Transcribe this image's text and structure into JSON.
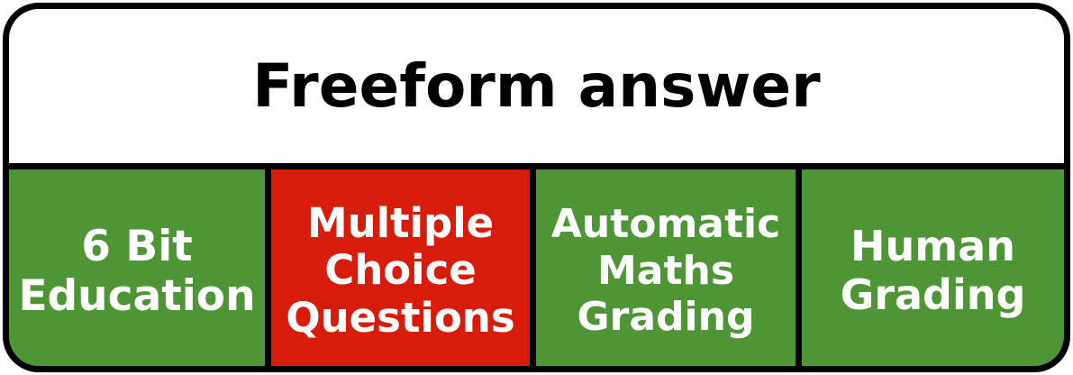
{
  "title": "Freeform answer",
  "cells": [
    {
      "label": "6 Bit\nEducation",
      "color": "#4e9535"
    },
    {
      "label": "Multiple\nChoice\nQuestions",
      "color": "#d81c0c"
    },
    {
      "label": "Automatic\nMaths\nGrading",
      "color": "#4e9535"
    },
    {
      "label": "Human\nGrading",
      "color": "#4e9535"
    }
  ],
  "colors": {
    "border": "#000000",
    "header_bg": "#ffffff",
    "text_light": "#ffffff"
  }
}
